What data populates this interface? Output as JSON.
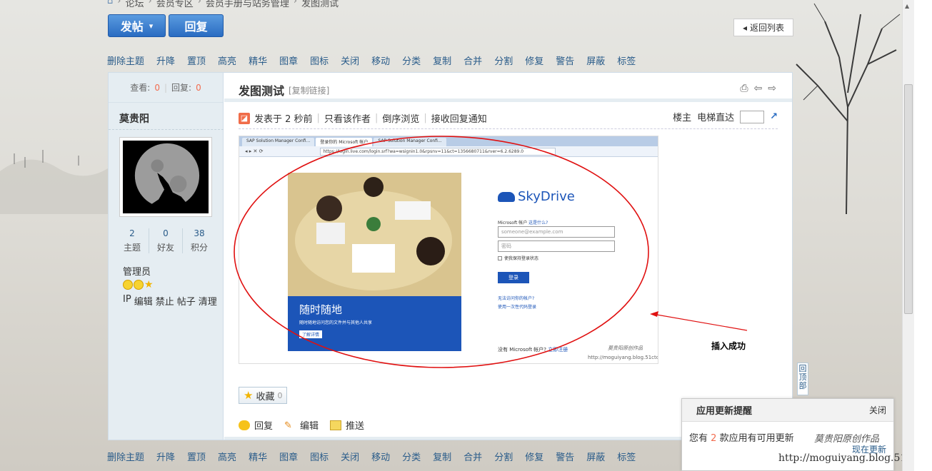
{
  "breadcrumb": [
    "论坛",
    "会员专区",
    "会员手册与站务管理",
    "发图测试"
  ],
  "buttons": {
    "post": "发帖",
    "post_caret": "▾",
    "reply": "回复",
    "back": "返回列表"
  },
  "modbar": [
    "删除主题",
    "升降",
    "置顶",
    "高亮",
    "精华",
    "图章",
    "图标",
    "关闭",
    "移动",
    "分类",
    "复制",
    "合并",
    "分割",
    "修复",
    "警告",
    "屏蔽",
    "标签"
  ],
  "stats": {
    "views_label": "查看:",
    "views": "0",
    "replies_label": "回复:",
    "replies": "0"
  },
  "user": {
    "name": "莫贵阳",
    "counts": [
      {
        "value": "2",
        "label": "主题"
      },
      {
        "value": "0",
        "label": "好友"
      },
      {
        "value": "38",
        "label": "积分"
      }
    ],
    "role": "管理员",
    "admin_links": [
      "IP",
      "编辑",
      "禁止",
      "帖子",
      "清理"
    ]
  },
  "post": {
    "title": "发图测试",
    "copy_link": "[复制链接]",
    "posted": "发表于 2 秒前",
    "only_author": "只看该作者",
    "reverse": "倒序浏览",
    "notify": "接收回复通知",
    "floor_owner": "楼主",
    "elevator": "电梯直达"
  },
  "screenshot": {
    "tabs": [
      "SAP Solution Manager Confi...",
      "登录你的 Microsoft 帐户",
      "SAP Solution Manager Confi..."
    ],
    "url": "https://login.live.com/login.srf?wa=wsignin1.0&rpsnv=11&ct=1356680711&rver=6.2.6289.0",
    "promo_title": "随时随地",
    "promo_sub": "随时随地访问您的文件并与其他人共享",
    "promo_btn": "了解详情",
    "brand": "SkyDrive",
    "account_label": "Microsoft 帐户",
    "whats_this": "这是什么?",
    "email_placeholder": "someone@example.com",
    "password_placeholder": "密码",
    "keep_signed": "使我保持登录状态",
    "login": "登录",
    "cant_access": "无法访问你的帐户?",
    "single_use": "使用一次性代码登录",
    "no_account": "没有 Microsoft 帐户?",
    "signup": "立即注册",
    "wm_name": "莫贵阳原创作品",
    "wm_url": "http://moguiyang.blog.51cto.com",
    "annotation": "插入成功"
  },
  "favorite": {
    "label": "收藏",
    "count": "0"
  },
  "actions": [
    "回复",
    "编辑",
    "推送"
  ],
  "to_top": "回顶部",
  "notice": {
    "title": "应用更新提醒",
    "close": "关闭",
    "prefix": "您有",
    "count": "2",
    "suffix": "款应用有可用更新",
    "update": "现在更新"
  },
  "watermark": {
    "name": "莫贵阳原创作品",
    "url": "http://moguiyang.blog.51cto.com"
  }
}
